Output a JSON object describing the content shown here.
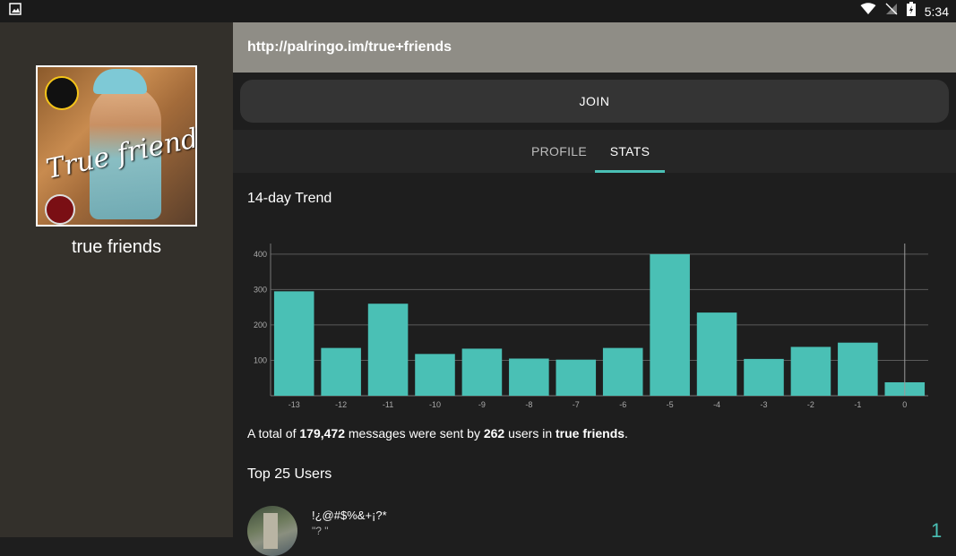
{
  "status": {
    "time": "5:34"
  },
  "group": {
    "name": "true friends",
    "cover_text": "True friends"
  },
  "url": "http://palringo.im/true+friends",
  "join_label": "JOIN",
  "tabs": [
    {
      "label": "PROFILE"
    },
    {
      "label": "STATS"
    }
  ],
  "trend_title": "14-day Trend",
  "summary": {
    "prefix": "A total of ",
    "messages": "179,472",
    "middle": " messages were sent by ",
    "users": "262",
    "middle2": " users in ",
    "group": "true friends",
    "suffix": "."
  },
  "top_users_title": "Top 25 Users",
  "top_users": [
    {
      "name": "!¿@#$%&+¡?*",
      "status": "\"? \"",
      "rank": "1"
    }
  ],
  "colors": {
    "accent": "#4ac0b5",
    "bar": "#4ac0b5",
    "url_bar": "#8f8d86",
    "sidebar": "#33302b"
  },
  "icons": {
    "notification": "image-icon",
    "wifi": "wifi-icon",
    "signal": "no-signal-icon",
    "battery": "battery-charging-icon"
  },
  "chart_data": {
    "type": "bar",
    "categories": [
      "-13",
      "-12",
      "-11",
      "-10",
      "-9",
      "-8",
      "-7",
      "-6",
      "-5",
      "-4",
      "-3",
      "-2",
      "-1",
      "0"
    ],
    "values": [
      295,
      135,
      260,
      118,
      133,
      105,
      102,
      135,
      400,
      235,
      104,
      138,
      150,
      38
    ],
    "title": "14-day Trend",
    "ylim": [
      0,
      430
    ],
    "yticks": [
      100,
      200,
      300,
      400
    ],
    "grid": true
  }
}
